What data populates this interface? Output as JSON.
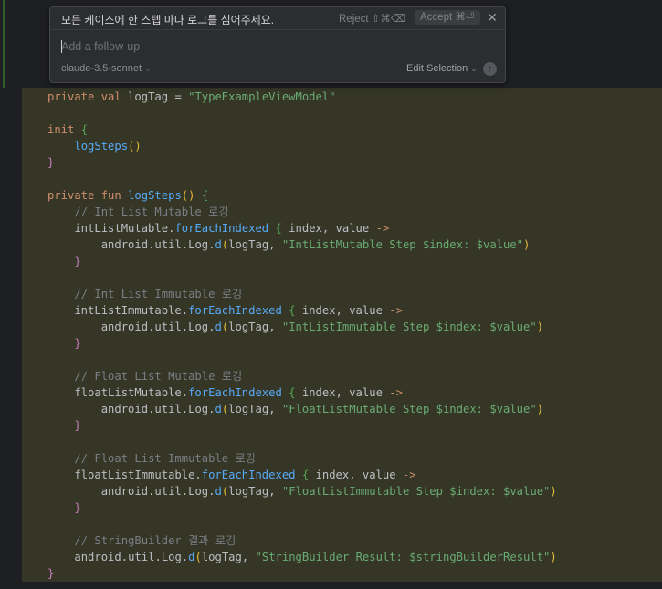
{
  "popup": {
    "prompt": "모든 케이스에 한 스텝 마다 로그를 심어주세요.",
    "reject_label": "Reject ⇧⌘⌫",
    "accept_label": "Accept ⌘⏎",
    "close_icon": "close-icon",
    "followup_placeholder": "Add a follow-up",
    "model": "claude-3.5-sonnet",
    "edit_selection": "Edit Selection",
    "send_icon": "arrow-up-icon"
  },
  "code": {
    "lines": [
      "private val logTag = \"TypeExampleViewModel\"",
      "",
      "init {",
      "    logSteps()",
      "}",
      "",
      "private fun logSteps() {",
      "    // Int List Mutable 로깅",
      "    intListMutable.forEachIndexed { index, value ->",
      "        android.util.Log.d(logTag, \"IntListMutable Step $index: $value\")",
      "    }",
      "",
      "    // Int List Immutable 로깅",
      "    intListImmutable.forEachIndexed { index, value ->",
      "        android.util.Log.d(logTag, \"IntListImmutable Step $index: $value\")",
      "    }",
      "",
      "    // Float List Mutable 로깅",
      "    floatListMutable.forEachIndexed { index, value ->",
      "        android.util.Log.d(logTag, \"FloatListMutable Step $index: $value\")",
      "    }",
      "",
      "    // Float List Immutable 로깅",
      "    floatListImmutable.forEachIndexed { index, value ->",
      "        android.util.Log.d(logTag, \"FloatListImmutable Step $index: $value\")",
      "    }",
      "",
      "    // StringBuilder 결과 로깅",
      "    android.util.Log.d(logTag, \"StringBuilder Result: $stringBuilderResult\")",
      "}"
    ]
  },
  "colors": {
    "diff_background": "#353626",
    "gutter_added": "#46a046",
    "keyword": "#cf8e6d",
    "string": "#6aab73",
    "comment": "#7a7e85"
  }
}
